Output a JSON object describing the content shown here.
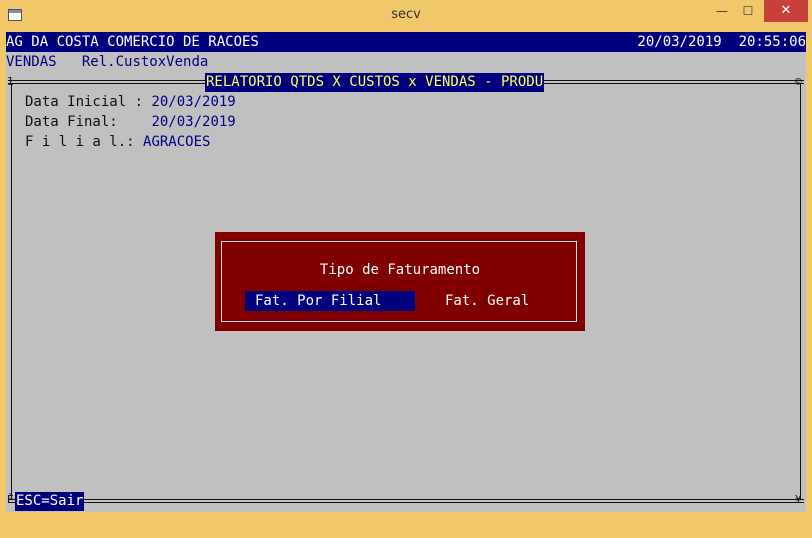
{
  "window": {
    "title": "secv",
    "min_glyph": "—",
    "max_glyph": "☐",
    "close_glyph": "✕"
  },
  "header": {
    "company": "AG DA COSTA COMERCIO DE RACOES",
    "date": "20/03/2019",
    "time": "20:55:06"
  },
  "breadcrumb": {
    "module": "VENDAS",
    "program": "Rel.CustoxVenda"
  },
  "report": {
    "title": "RELATORIO QTDS X CUSTOS x VENDAS - PRODU"
  },
  "frame": {
    "corner_tl": "1",
    "corner_tr": "©",
    "corner_bl": "È",
    "corner_br": "¥"
  },
  "fields": {
    "data_inicial_label": "Data Inicial : ",
    "data_inicial_value": "20/03/2019",
    "data_final_label": "Data Final:    ",
    "data_final_value": "20/03/2019",
    "filial_label": "F i l i a l.: ",
    "filial_value": "AGRACOES"
  },
  "dialog": {
    "title": "Tipo de Faturamento",
    "options": [
      {
        "label": "Fat. Por Filial",
        "selected": true
      },
      {
        "label": "Fat. Geral",
        "selected": false
      }
    ]
  },
  "footer": {
    "esc_label": "ESC=Sair"
  },
  "colors": {
    "console_bg": "#c0c0c0",
    "navy": "#00007f",
    "dialog_bg": "#800000",
    "title_yellow": "#ffff55",
    "window_frame": "#f0c869"
  }
}
